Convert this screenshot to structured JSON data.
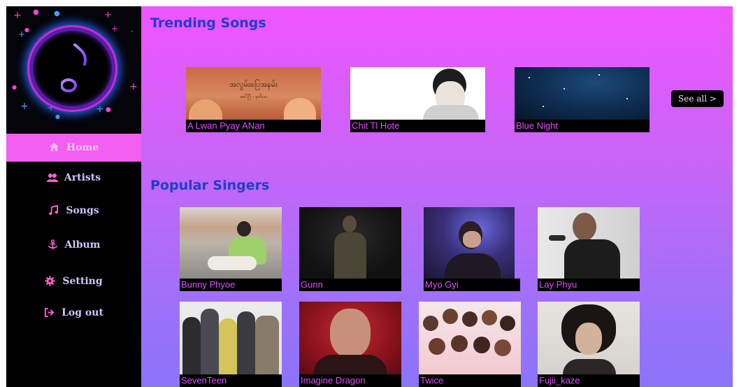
{
  "sidebar": {
    "logo_icon": "music-note-icon",
    "items": [
      {
        "label": "Home",
        "icon": "home-icon",
        "active": true
      },
      {
        "label": "Artists",
        "icon": "users-icon"
      },
      {
        "label": "Songs",
        "icon": "music-icon"
      },
      {
        "label": "Album",
        "icon": "anchor-icon"
      },
      {
        "label": "Setting",
        "icon": "gear-icon"
      },
      {
        "label": "Log out",
        "icon": "logout-icon"
      }
    ]
  },
  "trending": {
    "title": "Trending Songs",
    "see_all": "See all >",
    "songs": [
      {
        "title": "A Lwan Pyay ANan",
        "art_text": "အလွမ်းပြေအနမ်း",
        "art_sub": "ခေါ်ပြီ  ၊ ဒုတိယ"
      },
      {
        "title": "Chit Tl Hote"
      },
      {
        "title": "Blue Night"
      }
    ]
  },
  "popular": {
    "title": "Popular Singers",
    "singers": [
      {
        "name": "Bunny Phyoe"
      },
      {
        "name": "Gunn"
      },
      {
        "name": "Myo Gyi"
      },
      {
        "name": "Lay Phyu"
      },
      {
        "name": "SevenTeen"
      },
      {
        "name": "Imagine Dragon"
      },
      {
        "name": "Twice"
      },
      {
        "name": "Fujii_kaze"
      }
    ]
  },
  "colors": {
    "accent": "#f25ef0",
    "title_blue": "#1f3fc7",
    "caption_pink": "#e34bff",
    "gradient_top": "#ef55ff",
    "gradient_bottom": "#8a74fa"
  }
}
